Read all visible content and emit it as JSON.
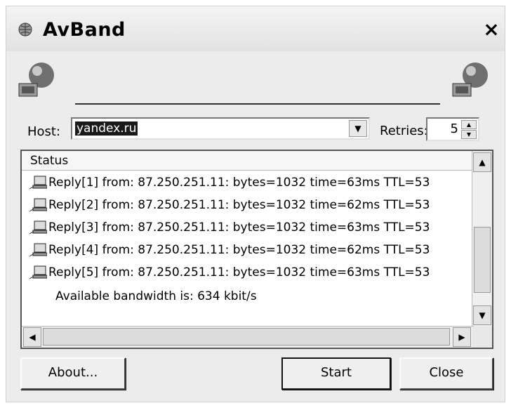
{
  "window": {
    "title": "AvBand",
    "close_glyph": "×",
    "icon": "globe-icon"
  },
  "host": {
    "label": "Host:",
    "value": "yandex.ru",
    "dropdown_glyph": "▼"
  },
  "retries": {
    "label": "Retries:",
    "value": "5",
    "up_glyph": "▲",
    "down_glyph": "▼"
  },
  "status": {
    "header": "Status",
    "rows": [
      "Reply[1] from: 87.250.251.11: bytes=1032 time=63ms TTL=53",
      "Reply[2] from: 87.250.251.11: bytes=1032 time=62ms TTL=53",
      "Reply[3] from: 87.250.251.11: bytes=1032 time=63ms TTL=53",
      "Reply[4] from: 87.250.251.11: bytes=1032 time=62ms TTL=53",
      "Reply[5] from: 87.250.251.11: bytes=1032 time=63ms TTL=53"
    ],
    "summary": "Available bandwidth is: 634 kbit/s"
  },
  "scroll": {
    "up": "▲",
    "down": "▼",
    "left": "◀",
    "right": "▶"
  },
  "buttons": {
    "about": "About...",
    "start": "Start",
    "close": "Close"
  }
}
